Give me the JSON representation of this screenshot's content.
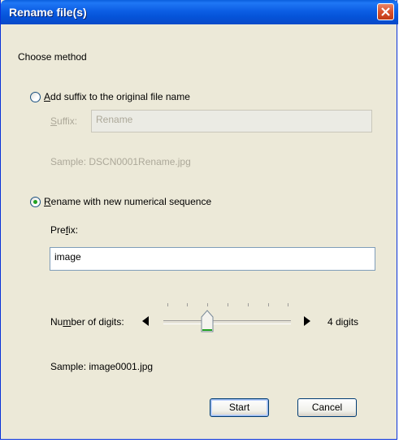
{
  "window": {
    "title": "Rename file(s)"
  },
  "section": {
    "choose_method": "Choose method"
  },
  "option_suffix": {
    "label_pre": "",
    "label_mnemonic": "A",
    "label_post": "dd suffix to the original file name",
    "selected": false,
    "suffix_label_mnemonic": "S",
    "suffix_label_post": "uffix:",
    "suffix_value": "Rename",
    "sample": "Sample: DSCN0001Rename.jpg"
  },
  "option_sequence": {
    "label_mnemonic": "R",
    "label_post": "ename with new numerical sequence",
    "selected": true,
    "prefix_label_pre": "Pre",
    "prefix_label_mnemonic": "f",
    "prefix_label_post": "ix:",
    "prefix_value": "image",
    "digits_label_pre": "Nu",
    "digits_label_mnemonic": "m",
    "digits_label_post": "ber of digits:",
    "digits": 4,
    "digits_range": [
      1,
      7
    ],
    "digits_text": "4 digits",
    "sample": "Sample: image0001.jpg"
  },
  "buttons": {
    "start": "Start",
    "cancel": "Cancel"
  },
  "colors": {
    "title_bar": "#0553d8",
    "close_button": "#d9512c",
    "dialog_bg": "#ece9d8",
    "radio_dot": "#21a121"
  }
}
